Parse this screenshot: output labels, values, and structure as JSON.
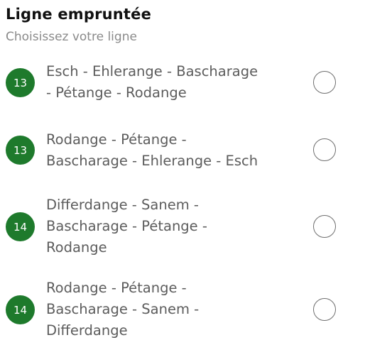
{
  "header": {
    "title": "Ligne empruntée",
    "subtitle": "Choisissez votre ligne"
  },
  "routes": [
    {
      "line": "13",
      "label": "Esch - Ehlerange - Bascharage\n- Pétange - Rodange",
      "selected": false
    },
    {
      "line": "13",
      "label": "Rodange - Pétange -\nBascharage - Ehlerange - Esch",
      "selected": false
    },
    {
      "line": "14",
      "label": "Differdange -  Sanem -\nBascharage - Pétange -\nRodange",
      "selected": false
    },
    {
      "line": "14",
      "label": "Rodange - Pétange -\nBascharage - Sanem -\nDifferdange",
      "selected": false
    }
  ],
  "colors": {
    "badge": "#1e7a2c",
    "title": "#111111",
    "text": "#5c5c5c"
  }
}
